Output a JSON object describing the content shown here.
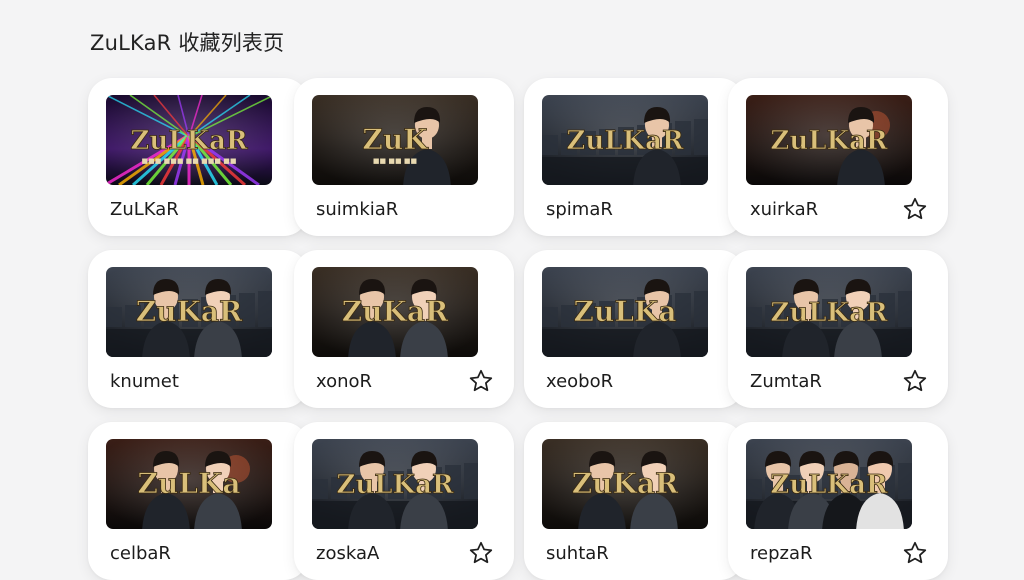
{
  "page": {
    "title": "ZuLKaR 收藏列表页"
  },
  "thumbnail_logo": "ZuLKaR",
  "cards": [
    {
      "title": "ZuLKaR",
      "logo": "ZuLKaR",
      "tagline": "■■■ ■■■ ■■ ■■■ ■■",
      "theme": "neon",
      "people": 0,
      "favorite_star": false
    },
    {
      "title": "suimkiaR",
      "logo": "ZuK",
      "tagline": "■■ ■■ ■■",
      "theme": "studio",
      "people": 1,
      "favorite_star": false
    },
    {
      "title": "spimaR",
      "logo": "ZuLKaR",
      "tagline": "",
      "theme": "city",
      "people": 1,
      "favorite_star": false
    },
    {
      "title": "xuirkaR",
      "logo": "ZuLKaR",
      "tagline": "",
      "theme": "warm",
      "people": 1,
      "favorite_star": true
    },
    {
      "title": "knumet",
      "logo": "ZuKaR",
      "tagline": "",
      "theme": "city",
      "people": 2,
      "favorite_star": false
    },
    {
      "title": "xonoR",
      "logo": "ZuKaR",
      "tagline": "",
      "theme": "studio",
      "people": 2,
      "favorite_star": true
    },
    {
      "title": "xeoboR",
      "logo": "ZuLKa",
      "tagline": "",
      "theme": "city",
      "people": 1,
      "favorite_star": false
    },
    {
      "title": "ZumtaR",
      "logo": "ZuLKaR",
      "tagline": "",
      "theme": "city",
      "people": 2,
      "favorite_star": true
    },
    {
      "title": "celbaR",
      "logo": "ZuLKa",
      "tagline": "",
      "theme": "warm",
      "people": 2,
      "favorite_star": false
    },
    {
      "title": "zoskaA",
      "logo": "ZuLKaR",
      "tagline": "",
      "theme": "city",
      "people": 2,
      "favorite_star": true
    },
    {
      "title": "suhtaR",
      "logo": "ZuKaR",
      "tagline": "",
      "theme": "studio",
      "people": 2,
      "favorite_star": false
    },
    {
      "title": "repzaR",
      "logo": "ZuLKaR",
      "tagline": "",
      "theme": "city",
      "people": 4,
      "favorite_star": true
    }
  ],
  "icons": {
    "star": "star-outline-icon"
  },
  "colors": {
    "background": "#f4f4f5",
    "card": "#ffffff",
    "logo_gold": "#d9bf7a"
  }
}
